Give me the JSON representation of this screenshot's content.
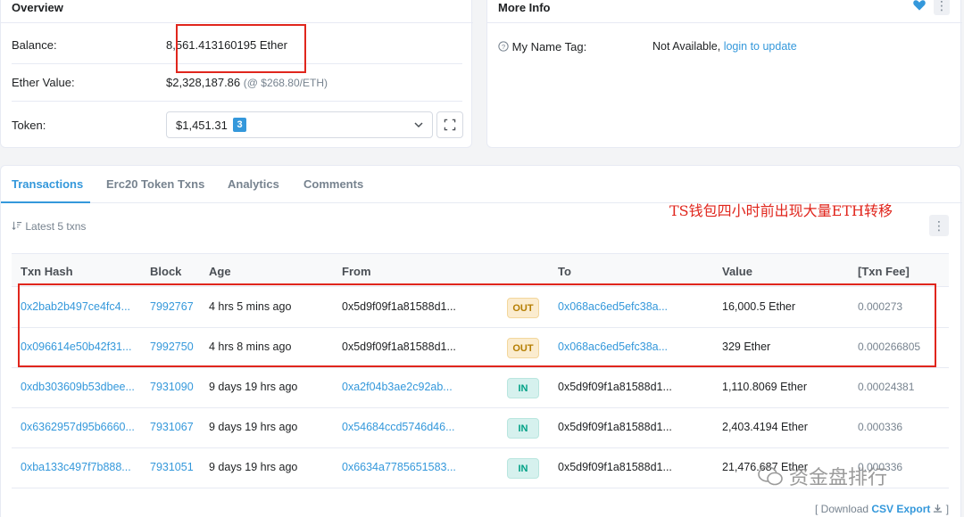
{
  "overview": {
    "title": "Overview",
    "balance_label": "Balance:",
    "balance_value": "8,561.413160195 Ether",
    "ether_value_label": "Ether Value:",
    "ether_value": "$2,328,187.86",
    "ether_price": "(@ $268.80/ETH)",
    "token_label": "Token:",
    "token_value": "$1,451.31",
    "token_count": "3"
  },
  "more_info": {
    "title": "More Info",
    "name_tag_label": "My Name Tag:",
    "name_tag_value": "Not Available,",
    "name_tag_link": "login to update"
  },
  "tabs": [
    "Transactions",
    "Erc20 Token Txns",
    "Analytics",
    "Comments"
  ],
  "latest_label": "Latest 5 txns",
  "annotation": "TS钱包四小时前出现大量ETH转移",
  "table": {
    "headers": [
      "Txn Hash",
      "Block",
      "Age",
      "From",
      "To",
      "Value",
      "[Txn Fee]"
    ],
    "rows": [
      {
        "hash": "0x2bab2b497ce4fc4...",
        "block": "7992767",
        "age": "4 hrs 5 mins ago",
        "from": "0x5d9f09f1a81588d1...",
        "dir": "OUT",
        "to": "0x068ac6ed5efc38a...",
        "value": "16,000.5 Ether",
        "fee": "0.000273"
      },
      {
        "hash": "0x096614e50b42f31...",
        "block": "7992750",
        "age": "4 hrs 8 mins ago",
        "from": "0x5d9f09f1a81588d1...",
        "dir": "OUT",
        "to": "0x068ac6ed5efc38a...",
        "value": "329 Ether",
        "fee": "0.000266805"
      },
      {
        "hash": "0xdb303609b53dbee...",
        "block": "7931090",
        "age": "9 days 19 hrs ago",
        "from": "0xa2f04b3ae2c92ab...",
        "dir": "IN",
        "to": "0x5d9f09f1a81588d1...",
        "value": "1,110.8069 Ether",
        "fee": "0.00024381"
      },
      {
        "hash": "0x6362957d95b6660...",
        "block": "7931067",
        "age": "9 days 19 hrs ago",
        "from": "0x54684ccd5746d46...",
        "dir": "IN",
        "to": "0x5d9f09f1a81588d1...",
        "value": "2,403.4194 Ether",
        "fee": "0.000336"
      },
      {
        "hash": "0xba133c497f7b888...",
        "block": "7931051",
        "age": "9 days 19 hrs ago",
        "from": "0x6634a7785651583...",
        "dir": "IN",
        "to": "0x5d9f09f1a81588d1...",
        "value": "21,476.687 Ether",
        "fee": "0.000336"
      }
    ]
  },
  "download": {
    "prefix": "[ Download ",
    "link": "CSV Export",
    "suffix": " ]"
  },
  "watermark": "资金盘排行",
  "colors": {
    "accent": "#3498db",
    "annotation_red": "#e0261d",
    "out_badge": "#fbeccf",
    "in_badge": "#d6f1ee"
  }
}
